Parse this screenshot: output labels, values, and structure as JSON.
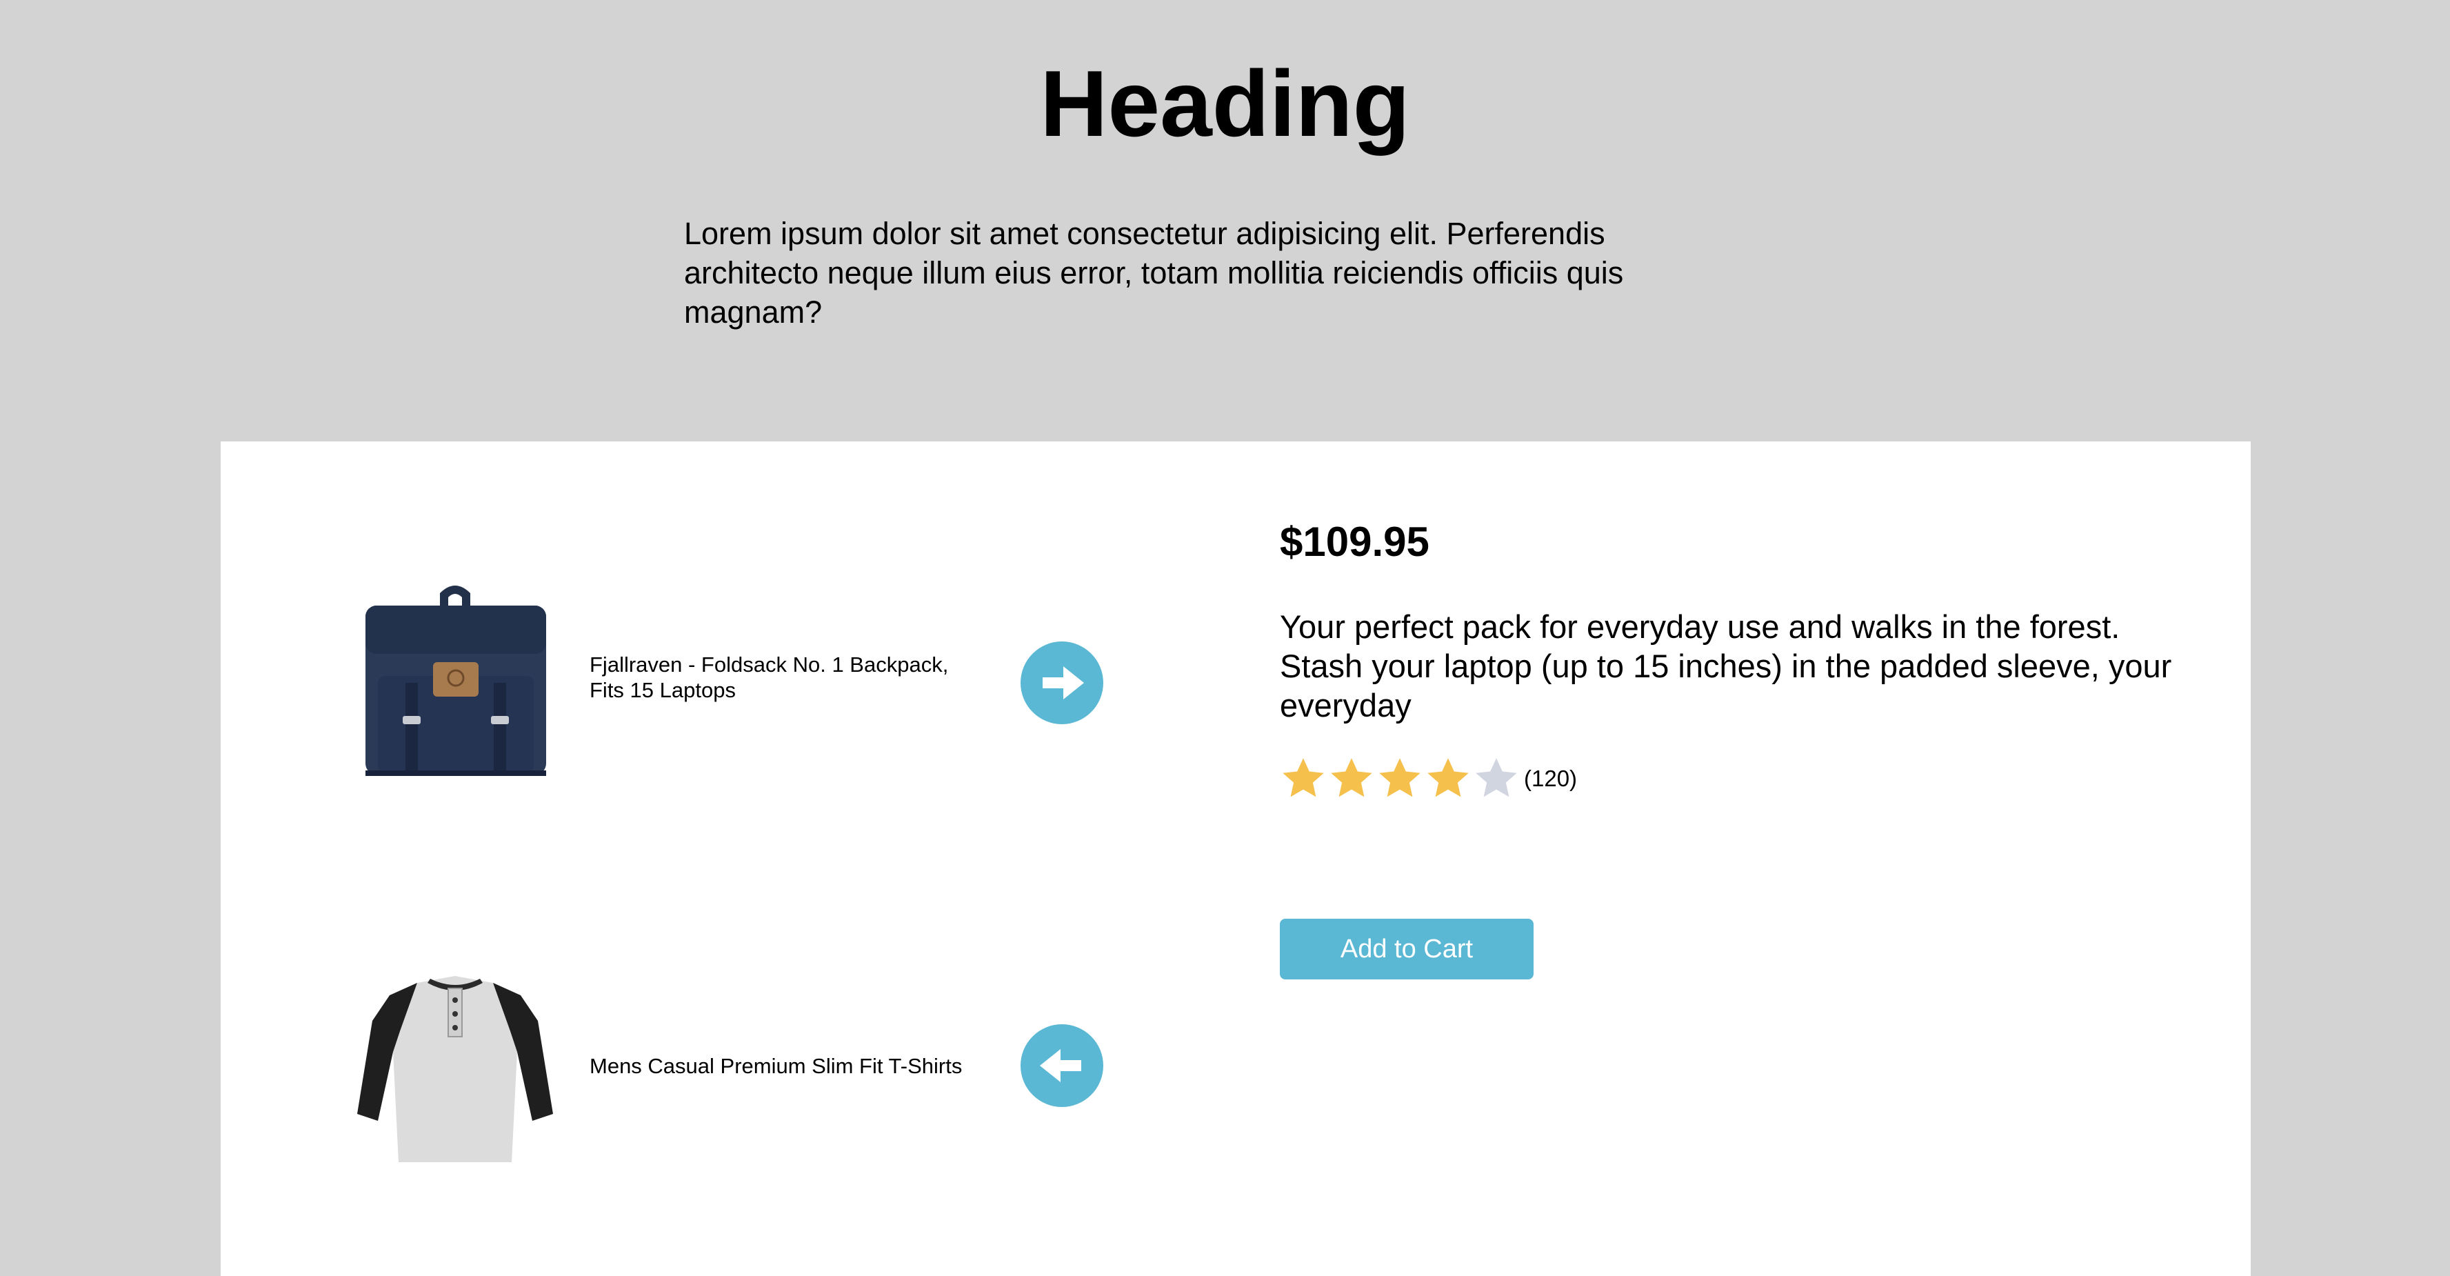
{
  "header": {
    "title": "Heading",
    "intro": "Lorem ipsum dolor sit amet consectetur adipisicing elit. Perferendis architecto neque illum eius error, totam mollitia reiciendis officiis quis magnam?"
  },
  "products": [
    {
      "name": "Fjallraven - Foldsack No. 1 Backpack, Fits 15 Laptops",
      "image_icon": "backpack-image",
      "nav_icon": "arrow-right-icon"
    },
    {
      "name": "Mens Casual Premium Slim Fit T-Shirts",
      "image_icon": "tshirt-image",
      "nav_icon": "arrow-left-icon"
    }
  ],
  "detail": {
    "price": "$109.95",
    "description": "Your perfect pack for everyday use and walks in the forest. Stash your laptop (up to 15 inches) in the padded sleeve, your everyday",
    "rating": {
      "value": 4,
      "max": 5,
      "count_label": "(120)"
    },
    "add_to_cart_label": "Add to Cart"
  },
  "colors": {
    "background": "#d3d3d3",
    "card": "#ffffff",
    "accent": "#5bb8d4",
    "star_filled": "#f5c04c",
    "star_empty": "#d1d5e0"
  }
}
